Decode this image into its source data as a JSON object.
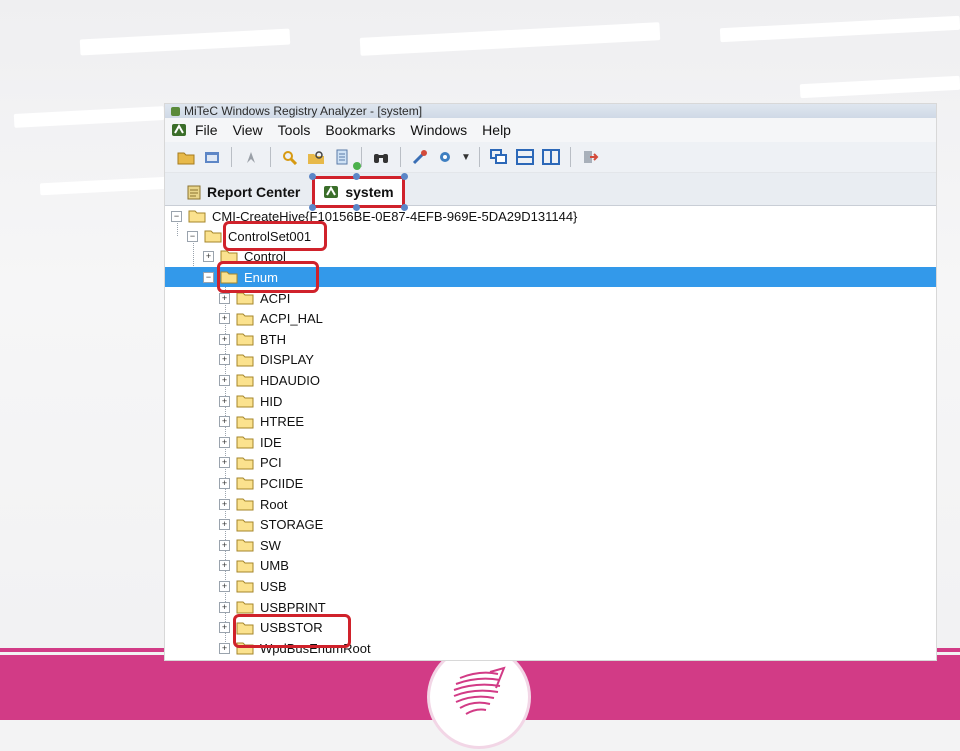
{
  "window": {
    "title": "MiTeC Windows Registry Analyzer - [system]"
  },
  "menu": [
    "File",
    "View",
    "Tools",
    "Bookmarks",
    "Windows",
    "Help"
  ],
  "toolbar": {
    "icons": [
      "open-folder-icon",
      "window-icon",
      "bookmark-icon",
      "search-icon",
      "find-folder-icon",
      "document-icon",
      "binoculars-icon",
      "tools-icon",
      "settings-gear-icon",
      "cascade-icon",
      "tile-horizontal-icon",
      "tile-vertical-icon",
      "exit-icon"
    ]
  },
  "tabs": [
    {
      "label": "Report Center",
      "active": false
    },
    {
      "label": "system",
      "active": true
    }
  ],
  "tree": {
    "root": "CMI-CreateHive{F10156BE-0E87-4EFB-969E-5DA29D131144}",
    "level1": "ControlSet001",
    "level2_control": "Control",
    "level2_selected": "Enum",
    "children": [
      "ACPI",
      "ACPI_HAL",
      "BTH",
      "DISPLAY",
      "HDAUDIO",
      "HID",
      "HTREE",
      "IDE",
      "PCI",
      "PCIIDE",
      "Root",
      "STORAGE",
      "SW",
      "UMB",
      "USB",
      "USBPRINT",
      "USBSTOR",
      "WpdBusEnumRoot"
    ]
  },
  "colors": {
    "selection": "#3399ea",
    "highlight": "#d0222b",
    "accent_band": "#d23b86"
  }
}
